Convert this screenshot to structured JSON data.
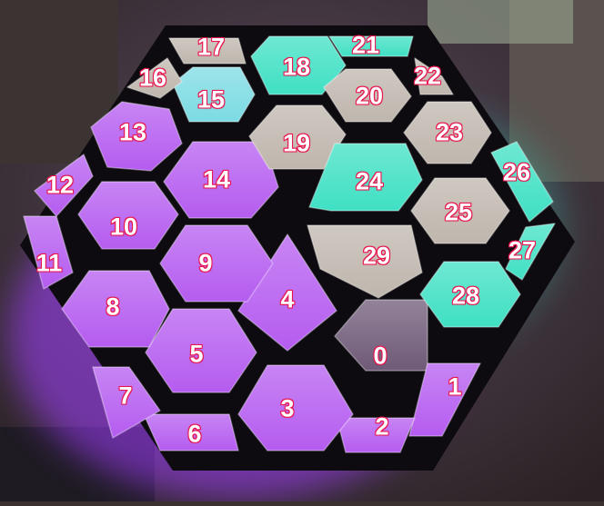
{
  "photo": {
    "colors": {
      "frame": "#0d0b0f",
      "wall": "#4a3f3c",
      "label_text": "#ffffff",
      "label_outline": "#e8174f",
      "violet": "#b55cf0",
      "cyan": "#3fe0c4",
      "cyan_light": "#7cdbe3",
      "beige": "#bfb6ad",
      "dark": "#6f5a78",
      "pink_purple": "#c77af5"
    },
    "segments": [
      {
        "id": "segment-0",
        "label": "0",
        "color": "dark"
      },
      {
        "id": "segment-1",
        "label": "1",
        "color": "violet"
      },
      {
        "id": "segment-2",
        "label": "2",
        "color": "violet"
      },
      {
        "id": "segment-3",
        "label": "3",
        "color": "violet"
      },
      {
        "id": "segment-4",
        "label": "4",
        "color": "violet"
      },
      {
        "id": "segment-5",
        "label": "5",
        "color": "violet"
      },
      {
        "id": "segment-6",
        "label": "6",
        "color": "violet"
      },
      {
        "id": "segment-7",
        "label": "7",
        "color": "violet"
      },
      {
        "id": "segment-8",
        "label": "8",
        "color": "violet"
      },
      {
        "id": "segment-9",
        "label": "9",
        "color": "violet"
      },
      {
        "id": "segment-10",
        "label": "10",
        "color": "violet"
      },
      {
        "id": "segment-11",
        "label": "11",
        "color": "violet"
      },
      {
        "id": "segment-12",
        "label": "12",
        "color": "violet"
      },
      {
        "id": "segment-13",
        "label": "13",
        "color": "violet"
      },
      {
        "id": "segment-14",
        "label": "14",
        "color": "violet"
      },
      {
        "id": "segment-15",
        "label": "15",
        "color": "cyan_light"
      },
      {
        "id": "segment-16",
        "label": "16",
        "color": "beige"
      },
      {
        "id": "segment-17",
        "label": "17",
        "color": "beige"
      },
      {
        "id": "segment-18",
        "label": "18",
        "color": "cyan"
      },
      {
        "id": "segment-19",
        "label": "19",
        "color": "beige"
      },
      {
        "id": "segment-20",
        "label": "20",
        "color": "beige"
      },
      {
        "id": "segment-21",
        "label": "21",
        "color": "cyan"
      },
      {
        "id": "segment-22",
        "label": "22",
        "color": "beige"
      },
      {
        "id": "segment-23",
        "label": "23",
        "color": "beige"
      },
      {
        "id": "segment-24",
        "label": "24",
        "color": "cyan"
      },
      {
        "id": "segment-25",
        "label": "25",
        "color": "beige"
      },
      {
        "id": "segment-26",
        "label": "26",
        "color": "cyan"
      },
      {
        "id": "segment-27",
        "label": "27",
        "color": "cyan"
      },
      {
        "id": "segment-28",
        "label": "28",
        "color": "cyan"
      },
      {
        "id": "segment-29",
        "label": "29",
        "color": "beige"
      }
    ]
  }
}
